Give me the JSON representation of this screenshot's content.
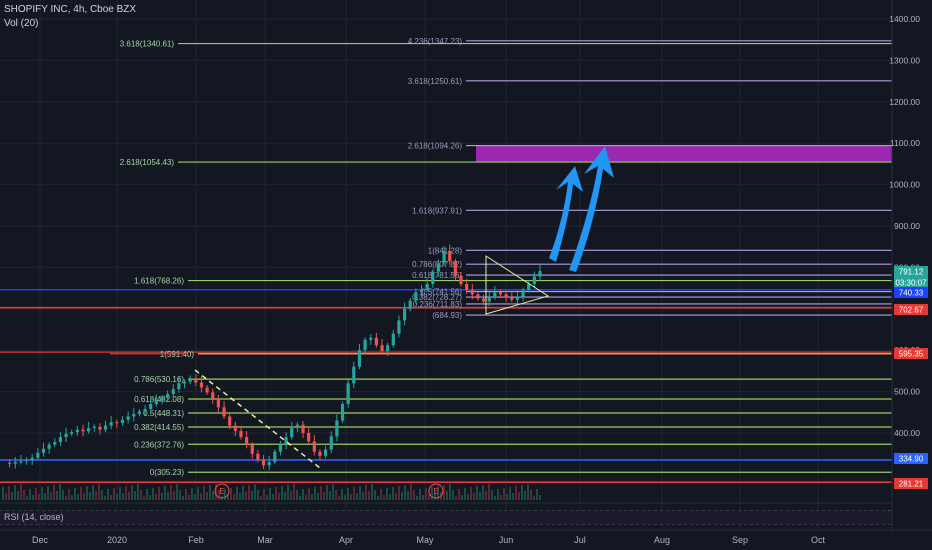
{
  "header": {
    "symbol": "SHOPIFY INC, 4h, Cboe BZX",
    "volume": "Vol (20)"
  },
  "rsi_label": "RSI (14, close)",
  "colors": {
    "background": "#131722",
    "grid": "#1f2430",
    "axis_text": "#b2b5be",
    "candle_up": "#26a69a",
    "candle_down": "#ef5350",
    "fib_green": "#9ccc65",
    "fib_green_text": "#a5d6a7",
    "fib_lavender": "#b39ddb",
    "fib_lavender_text": "#9e9aba",
    "target_zone": "#9c27b0",
    "arrow": "#2196f3",
    "blue_line": "#1e40ff",
    "red_line": "#e53935",
    "dashed_trend": "#e6ee9c"
  },
  "chart_data": {
    "type": "candlestick",
    "title": "SHOPIFY INC, 4h, Cboe BZX",
    "y_axis_ticks": [
      1400,
      1300,
      1200,
      1100,
      1000,
      900,
      800,
      700,
      600,
      500,
      400
    ],
    "y_axis_tick_labels": [
      "1400.00",
      "1300.00",
      "1200.00",
      "1100.00",
      "1000.00",
      "900.00",
      "800.00",
      "700.00",
      "600.00",
      "500.00",
      "400.00"
    ],
    "ylim": [
      260,
      1445
    ],
    "x_axis_labels": [
      "Dec",
      "2020",
      "Feb",
      "Mar",
      "Apr",
      "May",
      "Jun",
      "Jul",
      "Aug",
      "Sep",
      "Oct"
    ],
    "price_badges": [
      {
        "label": "791.12",
        "value": 791.12,
        "color": "#26a69a"
      },
      {
        "label": "03:30:07",
        "value": 775,
        "color": "#26a69a"
      },
      {
        "label": "740.33",
        "value": 746,
        "color": "#1e40ff"
      },
      {
        "label": "702.67",
        "value": 702.67,
        "color": "#e53935"
      },
      {
        "label": "595.35",
        "value": 595.35,
        "color": "#e53935"
      },
      {
        "label": "334.90",
        "value": 334.9,
        "color": "#2962ff"
      },
      {
        "label": "281.21",
        "value": 281.21,
        "color": "#e53935"
      }
    ],
    "fib_retracement_1": {
      "levels": [
        {
          "label": "0(305.23)",
          "value": 305.23
        },
        {
          "label": "0.236(372.76)",
          "value": 372.76
        },
        {
          "label": "0.382(414.55)",
          "value": 414.55
        },
        {
          "label": "0.5(448.31)",
          "value": 448.31
        },
        {
          "label": "0.618(482.08)",
          "value": 482.08
        },
        {
          "label": "0.786(530.16)",
          "value": 530.16
        },
        {
          "label": "1(591.40)",
          "value": 591.4
        },
        {
          "label": "1.618(768.26)",
          "value": 768.26
        },
        {
          "label": "2.618(1054.43)",
          "value": 1054.43
        },
        {
          "label": "3.618(1340.61)",
          "value": 1340.61
        }
      ]
    },
    "fib_retracement_2": {
      "levels": [
        {
          "label": "(684.93)",
          "value": 684.93
        },
        {
          "label": "0.236(711.83)",
          "value": 711.83
        },
        {
          "label": "0.382(728.27)",
          "value": 728.27
        },
        {
          "label": "0.5(741.56)",
          "value": 741.56
        },
        {
          "label": "0.618(781.56)",
          "value": 781.56
        },
        {
          "label": "0.786(807.82)",
          "value": 807.82
        },
        {
          "label": "1(841.28)",
          "value": 841.28
        },
        {
          "label": "1.618(937.91)",
          "value": 937.91
        },
        {
          "label": "2.618(1094.26)",
          "value": 1094.26
        },
        {
          "label": "3.618(1250.61)",
          "value": 1250.61
        },
        {
          "label": "4.236(1347.23)",
          "value": 1347.23
        }
      ]
    },
    "target_zone": {
      "from": 1054.43,
      "to": 1094.26
    },
    "horizontal_lines": [
      {
        "value": 746,
        "color": "#1e40ff"
      },
      {
        "value": 702.67,
        "color": "#e53935"
      },
      {
        "value": 334.9,
        "color": "#2962ff"
      },
      {
        "value": 281.21,
        "color": "#e53935"
      }
    ],
    "earnings_markers": [
      "E",
      "E"
    ],
    "price_series": {
      "description": "Shopify 4h closes, Nov 2019 to mid Jun 2020",
      "path_values": [
        328,
        326,
        330,
        332,
        335,
        340,
        352,
        362,
        372,
        378,
        390,
        398,
        402,
        408,
        404,
        412,
        415,
        408,
        418,
        426,
        424,
        432,
        440,
        446,
        452,
        458,
        470,
        478,
        486,
        494,
        506,
        520,
        524,
        530,
        522,
        510,
        498,
        480,
        462,
        440,
        418,
        405,
        390,
        372,
        350,
        335,
        322,
        330,
        355,
        372,
        390,
        412,
        420,
        400,
        380,
        355,
        345,
        360,
        392,
        430,
        470,
        520,
        560,
        600,
        625,
        630,
        612,
        598,
        612,
        640,
        672,
        700,
        720,
        740,
        746,
        760,
        790,
        810,
        840,
        815,
        780,
        760,
        745,
        735,
        725,
        718,
        728,
        740,
        735,
        728,
        722,
        730,
        745,
        760,
        778,
        791
      ]
    }
  }
}
